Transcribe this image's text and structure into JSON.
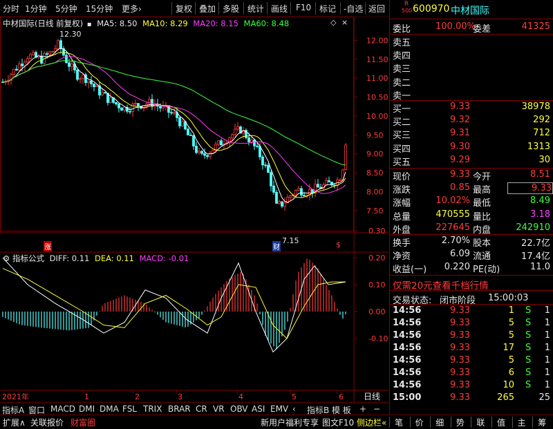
{
  "toolbar": {
    "left": [
      "分时",
      "1分钟",
      "5分钟",
      "15分钟",
      "更多›"
    ],
    "right": [
      "复权",
      "叠加",
      "多股",
      "统计",
      "画线",
      "F10",
      "标记",
      "-自选",
      "返回"
    ]
  },
  "main_chart": {
    "title": "中材国际(日线 前复权)",
    "ma5": "MA5: 8.50",
    "ma10": "MA10: 8.29",
    "ma20": "MA20: 8.15",
    "ma60": "MA60: 8.48",
    "high_label": "12.30",
    "low_label": "7.15",
    "markers": {
      "zhang": "涨",
      "cai": "财",
      "dollar": "$"
    },
    "y_ticks": [
      "12.00",
      "11.50",
      "11.00",
      "10.50",
      "10.00",
      "9.50",
      "9.00",
      "8.50",
      "8.00",
      "7.50"
    ],
    "colors": {
      "up": "#ff3b3b",
      "down": "#54ffff",
      "ma5": "#ffffff",
      "ma10": "#ffff3b",
      "ma20": "#ff3bff",
      "ma60": "#3bff3b"
    }
  },
  "macd": {
    "title": "指标公式",
    "diff": "DIFF: 0.11",
    "dea": "DEA: 0.11",
    "macd": "MACD: -0.01",
    "y_ticks": [
      "0.30",
      "0.20",
      "0.10",
      "0.00",
      "-0.10"
    ]
  },
  "x_axis": {
    "year": "2021年",
    "months": [
      "1",
      "2",
      "3",
      "4",
      "5",
      "6"
    ],
    "period": "日线"
  },
  "indicator_tabs": {
    "left": [
      "指标A",
      "窗口",
      "MACD",
      "DMI",
      "DMA",
      "FSL",
      "TRIX",
      "BRAR",
      "CR",
      "VR",
      "OBV",
      "ASI",
      "EMV",
      "‹"
    ],
    "right": [
      "指标B",
      "模 板",
      "+",
      "−"
    ]
  },
  "footer": {
    "left": [
      "扩展∧",
      "关联报价",
      "财富圈"
    ],
    "promo": "新用户福利专享",
    "right_tools": [
      "图文F10",
      "侧边栏«"
    ],
    "tabs": [
      "笔",
      "价",
      "细",
      "势",
      "联",
      "值",
      "主",
      "筹"
    ]
  },
  "quote": {
    "badge_top": "R",
    "badge_bottom": "500",
    "code": "600970",
    "name": "中材国际",
    "weibi_label": "委比",
    "weibi": "100.00%",
    "weicha_label": "委差",
    "weicha": "41325",
    "sell": [
      {
        "label": "卖五"
      },
      {
        "label": "卖四"
      },
      {
        "label": "卖三"
      },
      {
        "label": "卖二"
      },
      {
        "label": "卖一"
      }
    ],
    "buy": [
      {
        "label": "买一",
        "price": "9.33",
        "vol": "38978"
      },
      {
        "label": "买二",
        "price": "9.32",
        "vol": "292"
      },
      {
        "label": "买三",
        "price": "9.31",
        "vol": "712"
      },
      {
        "label": "买四",
        "price": "9.30",
        "vol": "1313"
      },
      {
        "label": "买五",
        "price": "9.29",
        "vol": "30"
      }
    ],
    "stats": [
      {
        "l1": "现价",
        "v1": "9.33",
        "l2": "今开",
        "v2": "8.51"
      },
      {
        "l1": "涨跌",
        "v1": "0.85",
        "l2": "最高",
        "v2": "9.33"
      },
      {
        "l1": "涨幅",
        "v1": "10.02%",
        "l2": "最低",
        "v2": "8.49"
      },
      {
        "l1": "总量",
        "v1": "470555",
        "l2": "量比",
        "v2": "3.18"
      },
      {
        "l1": "外盘",
        "v1": "227645",
        "l2": "内盘",
        "v2": "242910"
      }
    ],
    "stats2": [
      {
        "l1": "换手",
        "v1": "2.70%",
        "l2": "股本",
        "v2": "22.7亿"
      },
      {
        "l1": "净资",
        "v1": "6.09",
        "l2": "流通",
        "v2": "17.4亿"
      },
      {
        "l1": "收益(一)",
        "v1": "0.220",
        "l2": "PE(动)",
        "v2": "11.0"
      }
    ],
    "promo": "仅需20元查看千档行情",
    "status_label": "交易状态:",
    "status": "闭市阶段",
    "status_time": "15:00:03",
    "ticks": [
      {
        "t": "14:56",
        "p": "9.33",
        "v": "1",
        "f": "S",
        "n": "1"
      },
      {
        "t": "14:56",
        "p": "9.33",
        "v": "5",
        "f": "S",
        "n": "1"
      },
      {
        "t": "14:56",
        "p": "9.33",
        "v": "5",
        "f": "S",
        "n": "1"
      },
      {
        "t": "14:56",
        "p": "9.33",
        "v": "17",
        "f": "S",
        "n": "1"
      },
      {
        "t": "14:56",
        "p": "9.33",
        "v": "5",
        "f": "S",
        "n": "1"
      },
      {
        "t": "14:56",
        "p": "9.33",
        "v": "6",
        "f": "S",
        "n": "1"
      },
      {
        "t": "14:56",
        "p": "9.33",
        "v": "10",
        "f": "S",
        "n": "1"
      },
      {
        "t": "15:00",
        "p": "9.33",
        "v": "265",
        "f": "",
        "n": "25"
      }
    ]
  }
}
